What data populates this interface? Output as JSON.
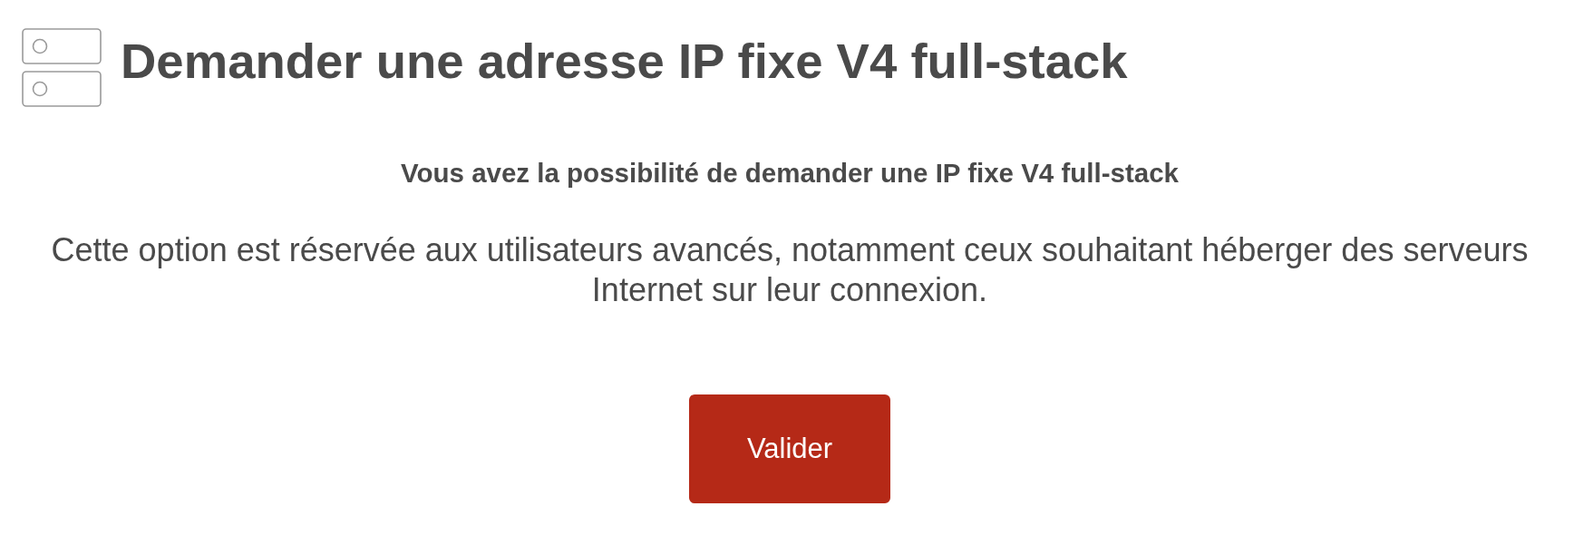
{
  "header": {
    "title": "Demander une adresse IP fixe V4 full-stack"
  },
  "subtitle": "Vous avez la possibilité de demander une IP fixe V4 full-stack",
  "description": "Cette option est réservée aux utilisateurs avancés, notamment ceux souhaitant héberger des serveurs Internet sur leur connexion.",
  "submit_button": {
    "label": "Valider"
  }
}
